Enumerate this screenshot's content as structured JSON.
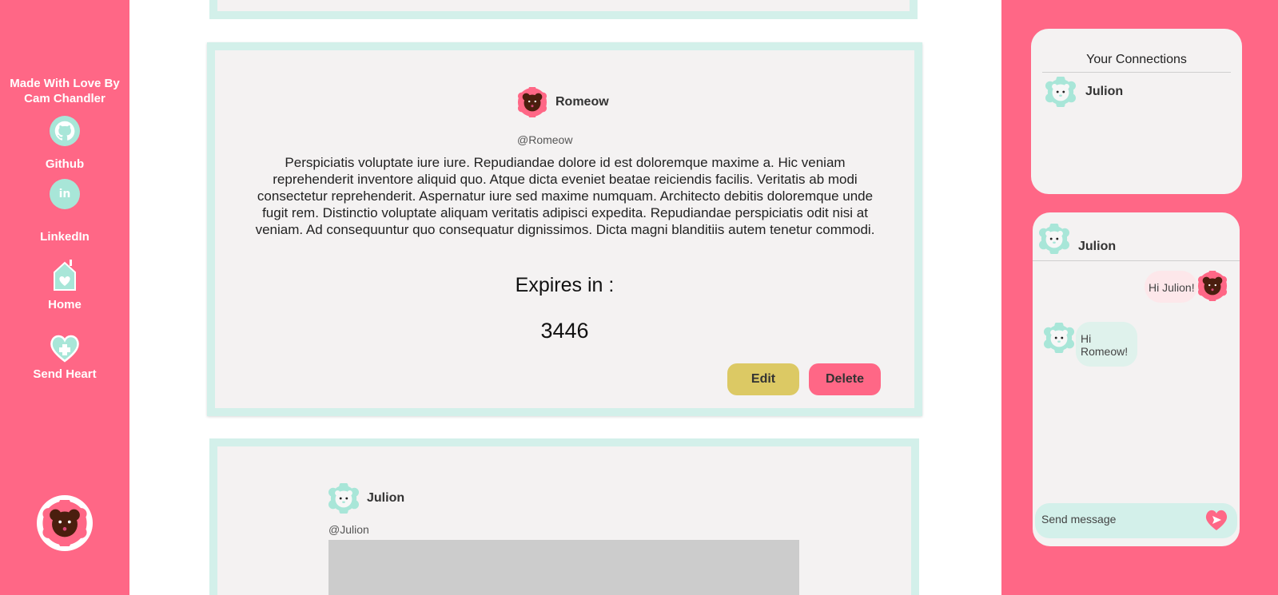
{
  "sidebar": {
    "credit": "Made With Love By Cam Chandler",
    "items": [
      {
        "label": "Github",
        "icon": "github-icon"
      },
      {
        "label": "LinkedIn",
        "icon": "linkedin-icon"
      },
      {
        "label": "Home",
        "icon": "home-heart-icon"
      },
      {
        "label": "Send Heart",
        "icon": "heart-plus-icon"
      }
    ],
    "avatar_icon": "bear-avatar-icon"
  },
  "feed": {
    "main_post": {
      "name": "Romeow",
      "handle": "@Romeow",
      "body": "Perspiciatis voluptate iure iure. Repudiandae dolore id est doloremque maxime a. Hic veniam reprehenderit inventore aliquid quo. Atque dicta eveniet beatae reiciendis facilis. Veritatis ab modi consectetur reprehenderit. Aspernatur iure sed maxime numquam. Architecto debitis doloremque unde fugit rem. Distinctio voluptate aliquam veritatis adipisci expedita. Repudiandae perspiciatis odit nisi at veniam. Ad consequuntur quo consequatur dignissimos. Dicta magni blanditiis autem tenetur commodi.",
      "expires_label": "Expires in :",
      "expires_value": "3446",
      "edit_label": "Edit",
      "delete_label": "Delete"
    },
    "next_post": {
      "name": "Julion",
      "handle": "@Julion"
    }
  },
  "connections": {
    "title": "Your Connections",
    "items": [
      {
        "name": "Julion"
      }
    ]
  },
  "chat": {
    "with": "Julion",
    "messages": [
      {
        "from": "Romeow",
        "text": "Hi Julion!"
      },
      {
        "from": "Julion",
        "text": "Hi Romeow!"
      }
    ],
    "input_placeholder": "Send message"
  },
  "colors": {
    "pink": "#ff6786",
    "mint": "#d3f0ea",
    "mint_icon": "#a8e6d8",
    "card": "#f4f2f2",
    "edit": "#dcc964"
  }
}
